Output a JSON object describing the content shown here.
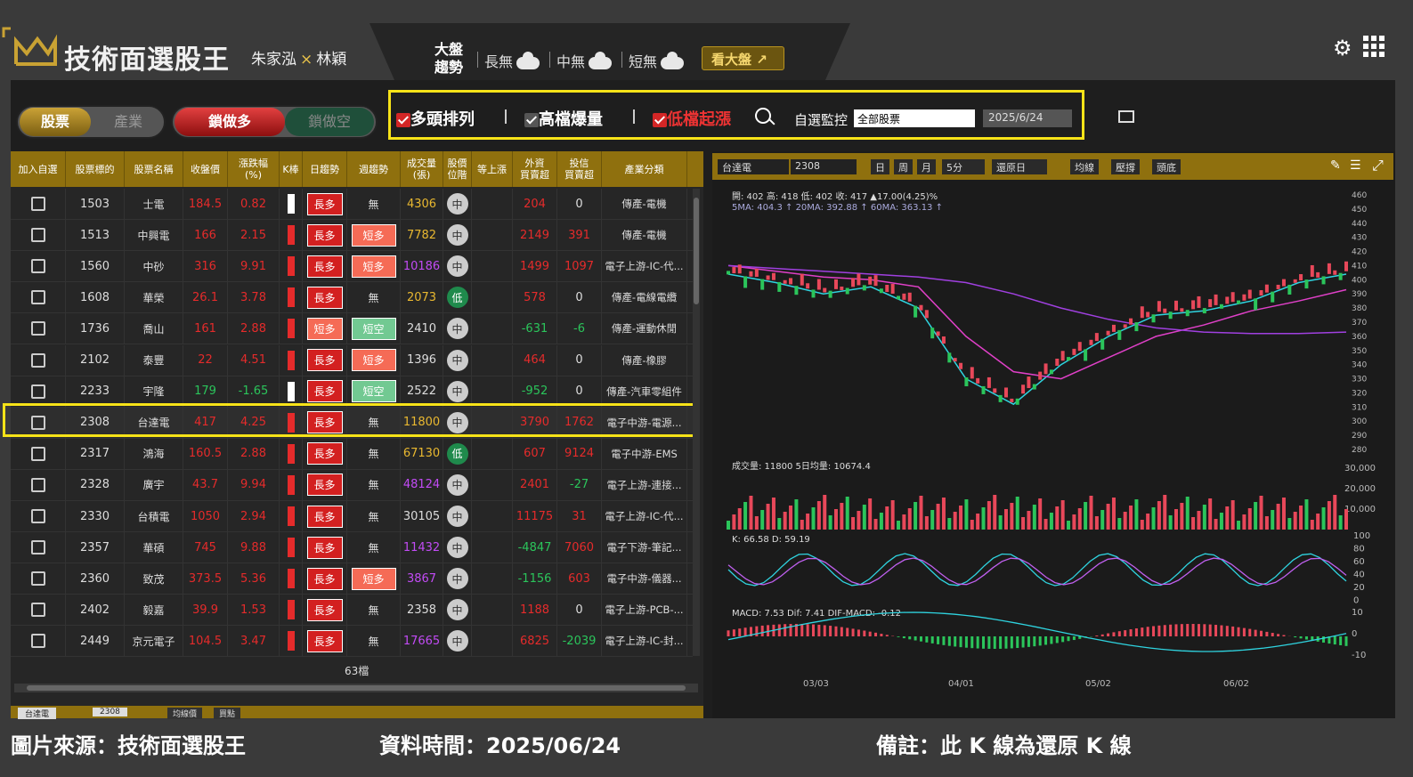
{
  "header": {
    "title": "技術面選股王",
    "author1": "朱家泓",
    "author_sep": "×",
    "author2": "林穎",
    "market_label_1": "大盤",
    "market_label_2": "趨勢",
    "trends": [
      {
        "label": "長無"
      },
      {
        "label": "中無"
      },
      {
        "label": "短無"
      }
    ],
    "view_market": "看大盤"
  },
  "tabs": {
    "stock": "股票",
    "industry": "產業",
    "long": "鎖做多",
    "short": "鎖做空"
  },
  "filters": {
    "f1": "多頭排列",
    "f2": "高檔爆量",
    "f3": "低檔起漲",
    "watch_label": "自選監控",
    "watch_value": "全部股票",
    "date": "2025/6/24"
  },
  "table": {
    "headers": [
      "加入自選",
      "股票標的",
      "股票名稱",
      "收盤價",
      "漲跌幅\n(%)",
      "K棒",
      "日趨勢",
      "週趨勢",
      "成交量\n(張)",
      "股價\n位階",
      "等上漲",
      "外資\n買賣超",
      "投信\n買賣超",
      "產業分類"
    ],
    "rows": [
      {
        "code": "1503",
        "name": "士電",
        "close": "184.5",
        "chg": "0.82",
        "day": "長多",
        "week": "無",
        "vol": "4306",
        "pos": "中",
        "fi": "204",
        "it": "0",
        "ind": "傳產-電機",
        "cc": "red",
        "vc": "yel",
        "fc": "red",
        "ic": "wht",
        "kc": "white"
      },
      {
        "code": "1513",
        "name": "中興電",
        "close": "166",
        "chg": "2.15",
        "day": "長多",
        "week": "短多",
        "vol": "7782",
        "pos": "中",
        "fi": "2149",
        "it": "391",
        "ind": "傳產-電機",
        "cc": "red",
        "vc": "yel",
        "fc": "red",
        "ic": "red",
        "kc": "red"
      },
      {
        "code": "1560",
        "name": "中砂",
        "close": "316",
        "chg": "9.91",
        "day": "長多",
        "week": "短多",
        "vol": "10186",
        "pos": "中",
        "fi": "1499",
        "it": "1097",
        "ind": "電子上游-IC-代...",
        "cc": "red",
        "vc": "pur",
        "fc": "red",
        "ic": "red",
        "kc": "red"
      },
      {
        "code": "1608",
        "name": "華榮",
        "close": "26.1",
        "chg": "3.78",
        "day": "長多",
        "week": "無",
        "vol": "2073",
        "pos": "低",
        "fi": "578",
        "it": "0",
        "ind": "傳產-電線電纜",
        "cc": "red",
        "vc": "yel",
        "fc": "red",
        "ic": "wht",
        "kc": "red"
      },
      {
        "code": "1736",
        "name": "喬山",
        "close": "161",
        "chg": "2.88",
        "day": "短多",
        "week": "短空",
        "vol": "2410",
        "pos": "中",
        "fi": "-631",
        "it": "-6",
        "ind": "傳產-運動休閒",
        "cc": "red",
        "vc": "wht",
        "fc": "green",
        "ic": "green",
        "kc": "red"
      },
      {
        "code": "2102",
        "name": "泰豐",
        "close": "22",
        "chg": "4.51",
        "day": "長多",
        "week": "短多",
        "vol": "1396",
        "pos": "中",
        "fi": "464",
        "it": "0",
        "ind": "傳產-橡膠",
        "cc": "red",
        "vc": "wht",
        "fc": "red",
        "ic": "wht",
        "kc": "red"
      },
      {
        "code": "2233",
        "name": "宇隆",
        "close": "179",
        "chg": "-1.65",
        "day": "長多",
        "week": "短空",
        "vol": "2522",
        "pos": "中",
        "fi": "-952",
        "it": "0",
        "ind": "傳產-汽車零組件",
        "cc": "green",
        "vc": "wht",
        "fc": "green",
        "ic": "wht",
        "kc": "white"
      },
      {
        "code": "2308",
        "name": "台達電",
        "close": "417",
        "chg": "4.25",
        "day": "長多",
        "week": "無",
        "vol": "11800",
        "pos": "中",
        "fi": "3790",
        "it": "1762",
        "ind": "電子中游-電源...",
        "cc": "red",
        "vc": "yel",
        "fc": "red",
        "ic": "red",
        "kc": "red"
      },
      {
        "code": "2317",
        "name": "鴻海",
        "close": "160.5",
        "chg": "2.88",
        "day": "長多",
        "week": "無",
        "vol": "67130",
        "pos": "低",
        "fi": "607",
        "it": "9124",
        "ind": "電子中游-EMS",
        "cc": "red",
        "vc": "yel",
        "fc": "red",
        "ic": "red",
        "kc": "red"
      },
      {
        "code": "2328",
        "name": "廣宇",
        "close": "43.7",
        "chg": "9.94",
        "day": "長多",
        "week": "無",
        "vol": "48124",
        "pos": "中",
        "fi": "2401",
        "it": "-27",
        "ind": "電子上游-連接...",
        "cc": "red",
        "vc": "pur",
        "fc": "red",
        "ic": "green",
        "kc": "red"
      },
      {
        "code": "2330",
        "name": "台積電",
        "close": "1050",
        "chg": "2.94",
        "day": "長多",
        "week": "無",
        "vol": "30105",
        "pos": "中",
        "fi": "11175",
        "it": "31",
        "ind": "電子上游-IC-代...",
        "cc": "red",
        "vc": "wht",
        "fc": "red",
        "ic": "red",
        "kc": "red"
      },
      {
        "code": "2357",
        "name": "華碩",
        "close": "745",
        "chg": "9.88",
        "day": "長多",
        "week": "無",
        "vol": "11432",
        "pos": "中",
        "fi": "-4847",
        "it": "7060",
        "ind": "電子下游-筆記...",
        "cc": "red",
        "vc": "pur",
        "fc": "green",
        "ic": "red",
        "kc": "red"
      },
      {
        "code": "2360",
        "name": "致茂",
        "close": "373.5",
        "chg": "5.36",
        "day": "長多",
        "week": "短多",
        "vol": "3867",
        "pos": "中",
        "fi": "-1156",
        "it": "603",
        "ind": "電子中游-儀器...",
        "cc": "red",
        "vc": "pur",
        "fc": "green",
        "ic": "red",
        "kc": "red"
      },
      {
        "code": "2402",
        "name": "毅嘉",
        "close": "39.9",
        "chg": "1.53",
        "day": "長多",
        "week": "無",
        "vol": "2358",
        "pos": "中",
        "fi": "1188",
        "it": "0",
        "ind": "電子上游-PCB-...",
        "cc": "red",
        "vc": "wht",
        "fc": "red",
        "ic": "wht",
        "kc": "red"
      },
      {
        "code": "2449",
        "name": "京元電子",
        "close": "104.5",
        "chg": "3.47",
        "day": "長多",
        "week": "無",
        "vol": "17665",
        "pos": "中",
        "fi": "6825",
        "it": "-2039",
        "ind": "電子上游-IC-封...",
        "cc": "red",
        "vc": "pur",
        "fc": "red",
        "ic": "green",
        "kc": "red"
      }
    ],
    "count": "63檔"
  },
  "chart": {
    "name": "台達電",
    "code": "2308",
    "btn_day": "日",
    "btn_week": "周",
    "btn_month": "月",
    "interval": "5分",
    "restore": "還原日",
    "b_avg": "均線",
    "b_press": "壓撐",
    "b_head": "頭底",
    "ohlc_text": "開: 402  高: 418  低: 402  收: 417  ▲17.00(4.25)%",
    "ma_text": "5MA: 404.3 ↑  20MA: 392.88 ↑  60MA: 363.13 ↑",
    "vol_text": "成交量: 11800  5日均量: 10674.4",
    "kd_text": "K: 66.58  D: 59.19",
    "macd_text": "MACD: 7.53  Dif: 7.41  DIF-MACD: -0.12",
    "dates": [
      "03/03",
      "04/01",
      "05/02",
      "06/02"
    ],
    "price_ticks": [
      "460",
      "450",
      "440",
      "430",
      "420",
      "410",
      "400",
      "390",
      "380",
      "370",
      "360",
      "350",
      "340",
      "330",
      "320",
      "310",
      "300",
      "290",
      "280"
    ],
    "vol_ticks": [
      "30,000",
      "20,000",
      "10,000"
    ],
    "kd_ticks": [
      "100",
      "80",
      "60",
      "40",
      "20",
      "0"
    ],
    "macd_ticks": [
      "10",
      "0",
      "-10"
    ]
  },
  "bottom": {
    "stock": "台達電",
    "code": "2308",
    "b1": "均線價",
    "b2": "買點"
  },
  "footer": {
    "source": "圖片來源：技術面選股王",
    "time": "資料時間：2025/06/24",
    "note": "備註：此 K 線為還原 K 線"
  },
  "chart_data": {
    "type": "line",
    "title": "",
    "x_labels": [
      "03/03",
      "04/01",
      "05/02",
      "06/02"
    ],
    "series": [
      {
        "name": "5MA",
        "values": [
          404,
          398,
          390,
          395,
          380,
          330,
          312,
          340,
          360,
          375,
          378,
          385,
          398,
          404
        ]
      },
      {
        "name": "20MA",
        "values": [
          410,
          406,
          402,
          400,
          395,
          360,
          335,
          330,
          345,
          360,
          368,
          378,
          385,
          393
        ]
      },
      {
        "name": "60MA",
        "values": [
          410,
          408,
          406,
          404,
          402,
          398,
          390,
          380,
          372,
          366,
          363,
          362,
          362,
          363
        ]
      }
    ],
    "ylim": [
      280,
      460
    ]
  }
}
